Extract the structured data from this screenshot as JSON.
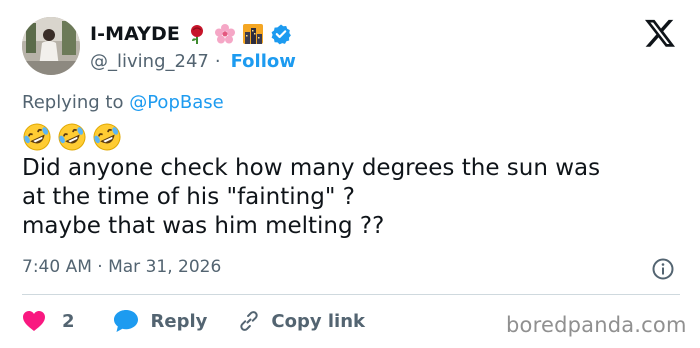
{
  "user": {
    "display_name": "I-MAYDE",
    "handle": "@_living_247",
    "separator": "·",
    "follow_label": "Follow",
    "badge_icons": [
      "rose-emoji",
      "cherry-blossom-emoji",
      "cityscape-emoji",
      "verified-badge-icon"
    ]
  },
  "reply_context": {
    "prefix": "Replying to",
    "mention": "@PopBase"
  },
  "tweet": {
    "emojis": [
      "rolling-on-floor-laughing-emoji",
      "rolling-on-floor-laughing-emoji",
      "rolling-on-floor-laughing-emoji"
    ],
    "text": "Did anyone check how many degrees the sun was\nat the time of his \"fainting\" ?\nmaybe that was him melting ??",
    "timestamp": "7:40 AM · Mar 31, 2026"
  },
  "actions": {
    "like_count": "2",
    "reply_label": "Reply",
    "copy_link_label": "Copy link"
  },
  "watermark": "boredpanda.com",
  "colors": {
    "accent": "#1d9bf0",
    "like": "#f91880",
    "secondary_text": "#536471",
    "divider": "#cfd9de"
  }
}
